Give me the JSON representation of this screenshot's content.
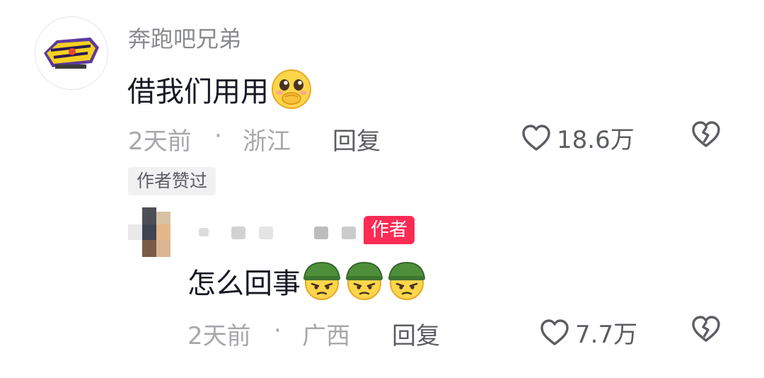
{
  "comment": {
    "username": "奔跑吧兄弟",
    "avatar_logo_text": "RUNNING MAN",
    "text": "借我们用用",
    "emoji": "pleading-face-emoji",
    "time": "2天前",
    "separator": "·",
    "location": "浙江",
    "reply_label": "回复",
    "likes": "18.6万",
    "author_liked_badge": "作者赞过"
  },
  "reply": {
    "author_badge": "作者",
    "text": "怎么回事",
    "emojis": [
      "soldier-helmet-emoji",
      "soldier-helmet-emoji",
      "soldier-helmet-emoji"
    ],
    "time": "2天前",
    "separator": "·",
    "location": "广西",
    "reply_label": "回复",
    "likes": "7.7万"
  },
  "colors": {
    "text_primary": "#161823",
    "text_secondary": "#8a8b91",
    "author_badge_bg": "#fe2c55",
    "liked_badge_bg": "#f1f1f2",
    "logo_yellow": "#f5d020",
    "logo_purple": "#5b3a9e"
  },
  "icons": [
    "heart-outline-icon",
    "broken-heart-icon"
  ]
}
